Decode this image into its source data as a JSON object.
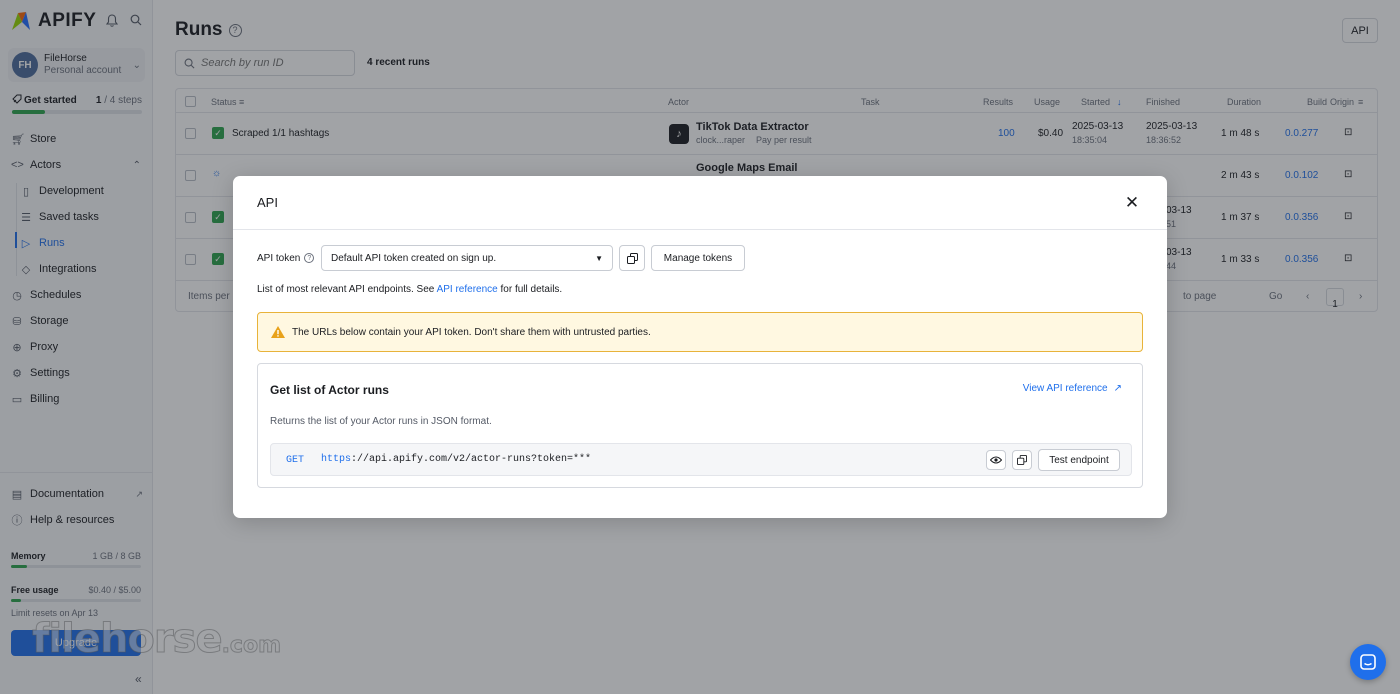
{
  "sidebar": {
    "brand": "APIFY",
    "account": {
      "name": "FileHorse",
      "type": "Personal account",
      "initials": "FH"
    },
    "get_started": {
      "label": "Get started",
      "steps_done": "1",
      "steps_total": "/ 4 steps",
      "progress": 0.25
    },
    "nav": [
      {
        "label": "Store"
      },
      {
        "label": "Actors"
      },
      {
        "label": "Development"
      },
      {
        "label": "Saved tasks"
      },
      {
        "label": "Runs"
      },
      {
        "label": "Integrations"
      },
      {
        "label": "Schedules"
      },
      {
        "label": "Storage"
      },
      {
        "label": "Proxy"
      },
      {
        "label": "Settings"
      },
      {
        "label": "Billing"
      }
    ],
    "bottom_links": [
      {
        "label": "Documentation"
      },
      {
        "label": "Help & resources"
      }
    ],
    "memory": {
      "label": "Memory",
      "value": "1 GB / 8 GB",
      "fraction": 0.125
    },
    "free_usage": {
      "label": "Free usage",
      "value": "$0.40 / $5.00",
      "fraction": 0.08
    },
    "limit_note": "Limit resets on Apr 13",
    "upgrade_label": "Upgrade"
  },
  "main": {
    "title": "Runs",
    "api_button": "API",
    "search_placeholder": "Search by run ID",
    "recent_runs": "4 recent runs",
    "columns": {
      "status": "Status",
      "actor": "Actor",
      "task": "Task",
      "results": "Results",
      "usage": "Usage",
      "started": "Started",
      "finished": "Finished",
      "duration": "Duration",
      "build": "Build",
      "origin": "Origin"
    },
    "rows": [
      {
        "status": "Scraped 1/1 hashtags",
        "actor": "TikTok Data Extractor",
        "actor_sub": "clock...raper",
        "pricing": "Pay per result",
        "results": "100",
        "usage": "$0.40",
        "started": "2025-03-13",
        "started_time": "18:35:04",
        "finished": "2025-03-13",
        "finished_time": "18:36:52",
        "duration": "1 m 48 s",
        "build": "0.0.277"
      },
      {
        "actor": "Google Maps Email",
        "duration": "2 m 43 s",
        "build": "0.0.102"
      },
      {
        "finished": "03-13",
        "finished_time": "51",
        "duration": "1 m 37 s",
        "build": "0.0.356"
      },
      {
        "finished": "03-13",
        "finished_time": "44",
        "duration": "1 m 33 s",
        "build": "0.0.356"
      }
    ],
    "footer": {
      "items_per_page": "Items per",
      "goto": "to page",
      "go": "Go",
      "page": "1"
    }
  },
  "modal": {
    "title": "API",
    "token_label": "API token",
    "token_value": "Default API token created on sign up.",
    "manage_tokens": "Manage tokens",
    "desc_prefix": "List of most relevant API endpoints. See ",
    "desc_link": "API reference",
    "desc_suffix": " for full details.",
    "warning": "The URLs below contain your API token. Don't share them with untrusted parties.",
    "endpoint_card": {
      "title": "Get list of Actor runs",
      "view_ref": "View API reference",
      "description": "Returns the list of your Actor runs in JSON format.",
      "method": "GET",
      "url_scheme": "https",
      "url_rest": "://api.apify.com/v2/actor-runs?token=***",
      "test_label": "Test endpoint"
    }
  },
  "watermark": {
    "main": "filehorse",
    "suffix": ".com"
  },
  "colors": {
    "accent": "#1f6feb",
    "success": "#2ea44f",
    "warning_bg": "#fff8e1",
    "warning_border": "#e8b33a"
  }
}
